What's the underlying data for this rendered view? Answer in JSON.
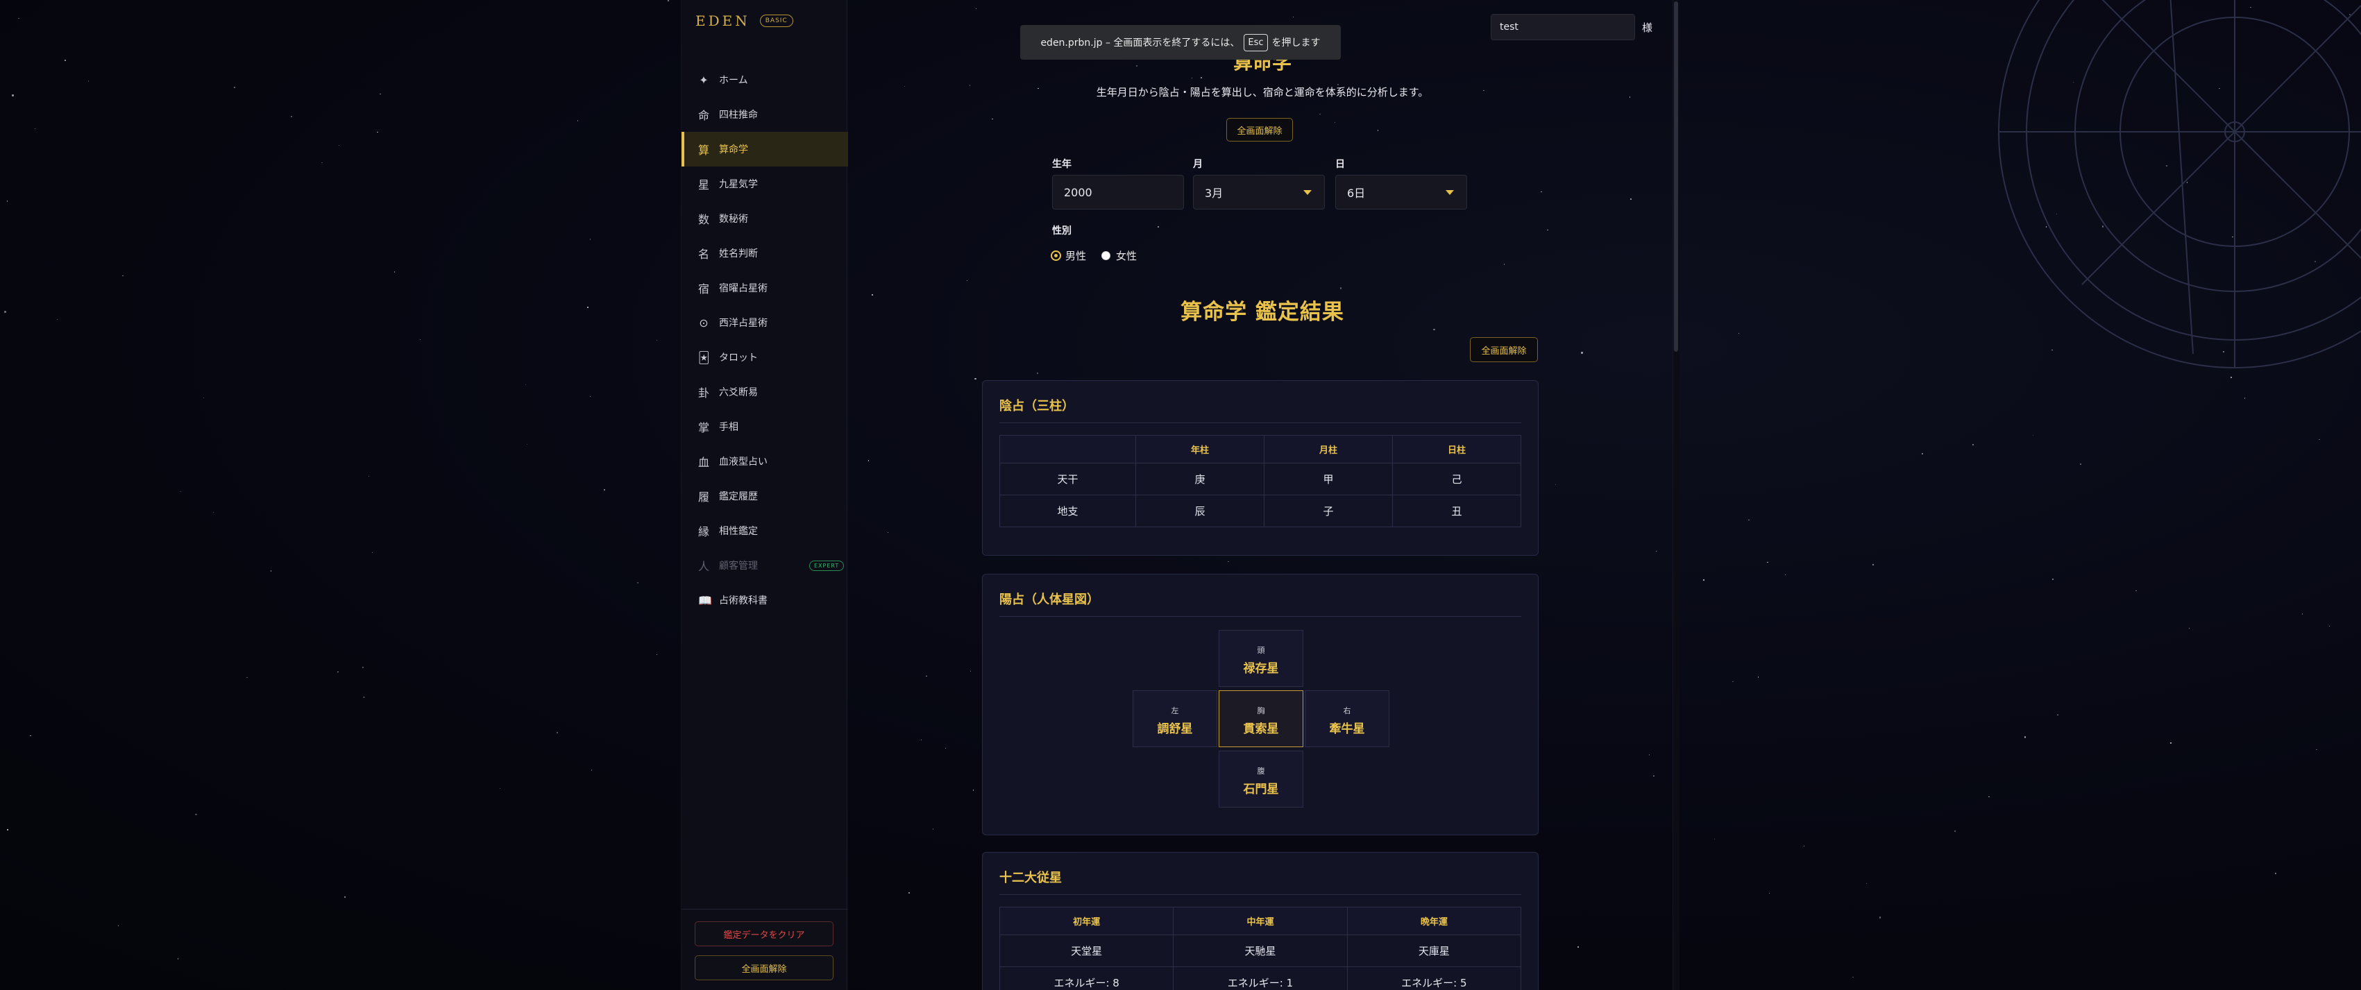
{
  "brand": {
    "name": "EDEN",
    "plan": "BASIC"
  },
  "nav": [
    {
      "icon": "✦",
      "label": "ホーム",
      "name": "home"
    },
    {
      "icon": "命",
      "label": "四柱推命",
      "name": "shichu-suimei"
    },
    {
      "icon": "算",
      "label": "算命学",
      "name": "sanmeigaku",
      "active": true
    },
    {
      "icon": "星",
      "label": "九星気学",
      "name": "kyusei-kigaku"
    },
    {
      "icon": "数",
      "label": "数秘術",
      "name": "numerology"
    },
    {
      "icon": "名",
      "label": "姓名判断",
      "name": "seimei-handan"
    },
    {
      "icon": "宿",
      "label": "宿曜占星術",
      "name": "sukuyo"
    },
    {
      "icon": "⊙",
      "label": "西洋占星術",
      "name": "western-astrology"
    },
    {
      "icon": "🃏",
      "label": "タロット",
      "name": "tarot"
    },
    {
      "icon": "卦",
      "label": "六爻断易",
      "name": "rikko"
    },
    {
      "icon": "掌",
      "label": "手相",
      "name": "palmistry"
    },
    {
      "icon": "血",
      "label": "血液型占い",
      "name": "blood-type"
    },
    {
      "icon": "履",
      "label": "鑑定履歴",
      "name": "history"
    },
    {
      "icon": "縁",
      "label": "相性鑑定",
      "name": "compatibility"
    },
    {
      "icon": "人",
      "label": "顧客管理",
      "name": "customers",
      "disabled": true,
      "badge": "EXPERT"
    },
    {
      "icon": "📖",
      "label": "占術教科書",
      "name": "textbook"
    }
  ],
  "sidebar_buttons": {
    "clear": "鑑定データをクリア",
    "exit_full": "全画面解除"
  },
  "fullscreen_toast": {
    "before": "eden.prbn.jp – 全画面表示を終了するには、",
    "key": "Esc",
    "after": "を押します"
  },
  "search": {
    "value": "test",
    "suffix": "様"
  },
  "page": {
    "title": "算命学",
    "subtitle": "生年月日から陰占・陽占を算出し、宿命と運命を体系的に分析します。",
    "exit_full_label": "全画面解除"
  },
  "form": {
    "year_label": "生年",
    "year_value": "2000",
    "month_label": "月",
    "month_value": "3月",
    "day_label": "日",
    "day_value": "6日",
    "gender_label": "性別",
    "gender_options": [
      "男性",
      "女性"
    ],
    "gender_selected": "男性"
  },
  "result": {
    "title": "算命学 鑑定結果",
    "exit_full_label": "全画面解除",
    "inzen": {
      "title": "陰占（三柱）",
      "headers": [
        "",
        "年柱",
        "月柱",
        "日柱"
      ],
      "rows": [
        [
          "天干",
          "庚",
          "甲",
          "己"
        ],
        [
          "地支",
          "辰",
          "子",
          "丑"
        ]
      ]
    },
    "yozen": {
      "title": "陽占（人体星図）",
      "head": {
        "pos": "頭",
        "star": "禄存星"
      },
      "left": {
        "pos": "左",
        "star": "調舒星"
      },
      "center": {
        "pos": "胸",
        "star": "貫索星"
      },
      "right": {
        "pos": "右",
        "star": "牽牛星"
      },
      "belly": {
        "pos": "腹",
        "star": "石門星"
      }
    },
    "juudai": {
      "title": "十二大従星",
      "headers": [
        "初年運",
        "中年運",
        "晩年運"
      ],
      "stars": [
        "天堂星",
        "天馳星",
        "天庫星"
      ],
      "energy": [
        "エネルギー: 8",
        "エネルギー: 1",
        "エネルギー: 5"
      ]
    }
  },
  "colors": {
    "accent": "#e9c24c",
    "background": "#05060c",
    "card": "#121325",
    "danger": "#e24848",
    "expert": "#2fbf6a"
  }
}
